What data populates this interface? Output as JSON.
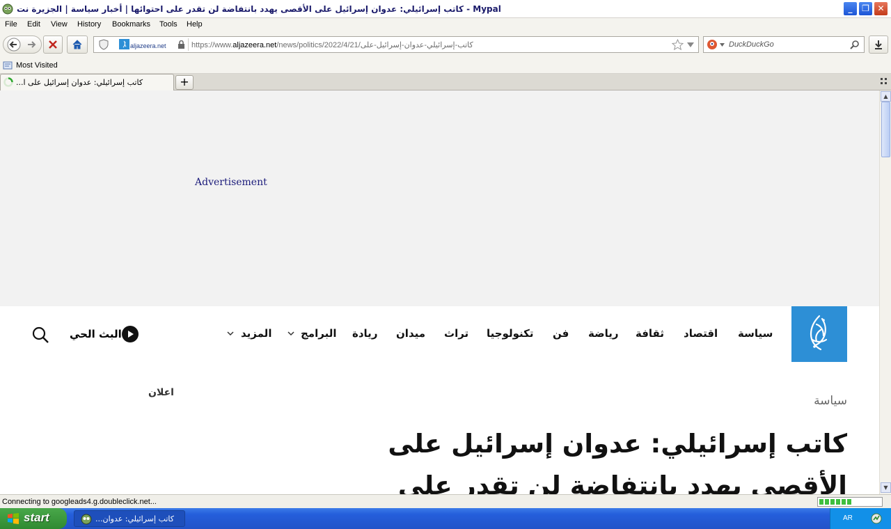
{
  "window": {
    "title": "كاتب إسرائيلي: عدوان إسرائيل على الأقصى يهدد بانتفاضة لن تقدر على احتوائها | أخبار سياسة | الجزيرة نت - Mypal"
  },
  "menu": {
    "items": [
      "File",
      "Edit",
      "View",
      "History",
      "Bookmarks",
      "Tools",
      "Help"
    ]
  },
  "navbar": {
    "site_name": "aljazeera.net",
    "url_prefix": "https://www.",
    "url_domain": "aljazeera.net",
    "url_path": "/news/politics/2022/4/21/كاتب-إسرائيلي-عدوان-إسرائيل-على",
    "search_placeholder": "DuckDuckGo"
  },
  "bookmarks": {
    "most_visited": "Most Visited"
  },
  "tabs": [
    {
      "label": "...كاتب إسرائيلي: عدوان إسرائيل على ا"
    }
  ],
  "page": {
    "ad_text": "Advertisement",
    "nav_items": [
      {
        "label": "سياسة"
      },
      {
        "label": "اقتصاد"
      },
      {
        "label": "ثقافة"
      },
      {
        "label": "رياضة"
      },
      {
        "label": "فن"
      },
      {
        "label": "تكنولوجيا"
      },
      {
        "label": "تراث"
      },
      {
        "label": "ميدان"
      },
      {
        "label": "ريادة"
      },
      {
        "label": "البرامج"
      },
      {
        "label": "المزيد"
      }
    ],
    "live_label": "البث الحي",
    "ad_label": "اعلان",
    "category": "سياسة",
    "headline": "كاتب إسرائيلي: عدوان إسرائيل على الأقصى يهدد بانتفاضة لن تقدر على احتوائها"
  },
  "status": {
    "text": "Connecting to googleads4.g.doubleclick.net...",
    "progress": 0.55
  },
  "taskbar": {
    "start": "start",
    "task_label": "...كاتب إسرائيلي: عدوان",
    "language": "AR"
  },
  "colors": {
    "brand_blue": "#2d8fd6",
    "taskbar_blue": "#245edb",
    "start_green": "#2f8a31"
  }
}
